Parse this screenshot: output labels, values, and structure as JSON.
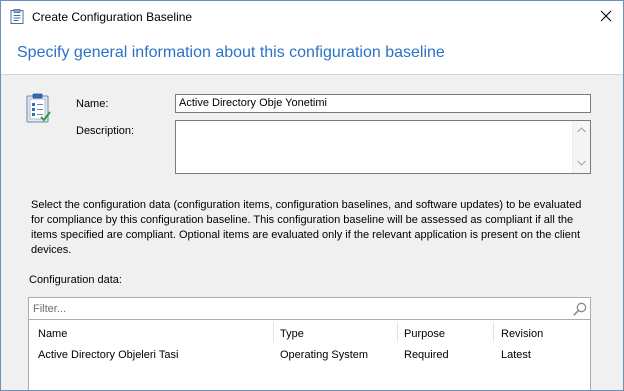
{
  "window": {
    "title": "Create Configuration Baseline",
    "header": "Specify general information about this configuration baseline"
  },
  "form": {
    "name_label": "Name:",
    "name_value": "Active Directory Obje Yonetimi",
    "description_label": "Description:",
    "description_value": ""
  },
  "info_text": "Select the configuration data (configuration items, configuration baselines, and software updates) to be evaluated for compliance by this configuration baseline. This configuration baseline will be assessed as compliant if all the items specified are compliant. Optional items are evaluated only if the relevant application is present on  the client devices.",
  "config_data": {
    "label": "Configuration data:",
    "filter_placeholder": "Filter...",
    "columns": [
      "Name",
      "Type",
      "Purpose",
      "Revision"
    ],
    "rows": [
      [
        "Active Directory Objeleri Tasi",
        "Operating System",
        "Required",
        "Latest"
      ]
    ]
  },
  "colors": {
    "header_text": "#2a72c8",
    "window_border": "#6e8fb8",
    "background": "#f0f0f0"
  },
  "icons": {
    "title": "configuration-baseline-icon",
    "wizard": "clipboard-checklist-icon",
    "close": "close-icon",
    "search": "search-icon"
  }
}
